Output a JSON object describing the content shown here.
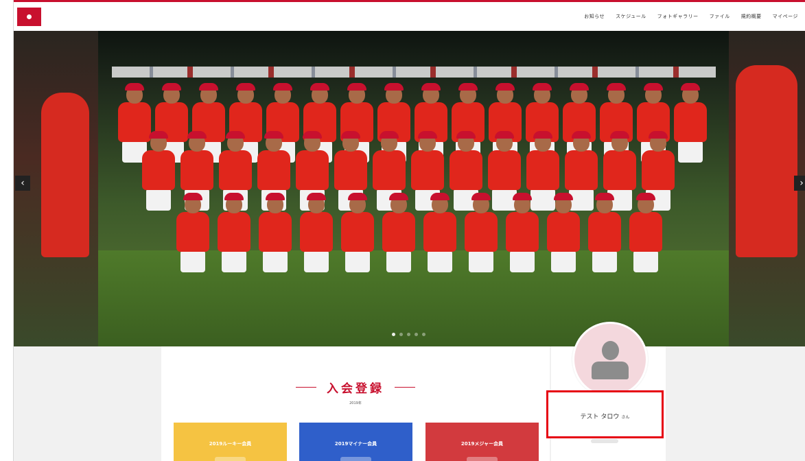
{
  "header": {
    "nav": [
      {
        "label": "お知らせ"
      },
      {
        "label": "スケジュール"
      },
      {
        "label": "フォトギャラリー"
      },
      {
        "label": "ファイル"
      },
      {
        "label": "規約概要"
      },
      {
        "label": "マイページ"
      }
    ]
  },
  "slider": {
    "prev_glyph": "‹",
    "next_glyph": "›",
    "slide_count": 5,
    "active_slide": 1
  },
  "registration": {
    "title": "入会登録",
    "subtitle": "2019年",
    "plans": [
      {
        "label": "2019ルーキー会員",
        "color": "#f5c342"
      },
      {
        "label": "2019マイナー会員",
        "color": "#2f5fca"
      },
      {
        "label": "2019メジャー会員",
        "color": "#d23a3e"
      }
    ]
  },
  "profile": {
    "avatar_icon": "user-silhouette-icon",
    "name": "テスト タロウ",
    "suffix": "さん"
  },
  "colors": {
    "brand": "#c8102e",
    "highlight_box": "#e60012"
  }
}
